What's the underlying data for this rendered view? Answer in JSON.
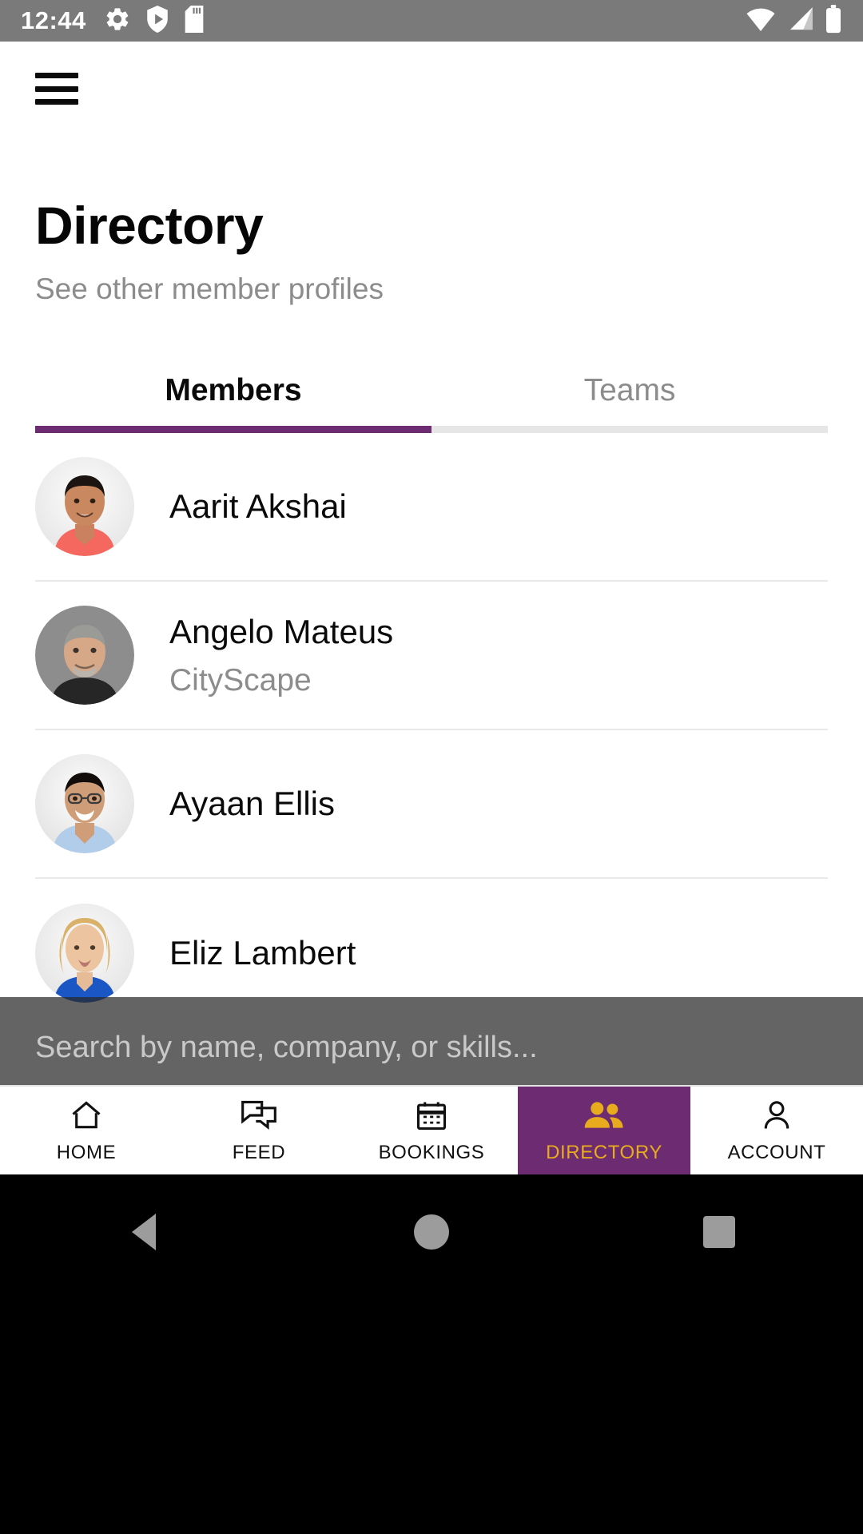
{
  "status_bar": {
    "time": "12:44",
    "left_icons": [
      "gear-icon",
      "shield-play-icon",
      "sd-card-icon"
    ],
    "right_icons": [
      "wifi-icon",
      "cell-signal-icon",
      "battery-icon"
    ],
    "background_color": "#7a7a7a"
  },
  "appbar": {
    "menu_icon": "hamburger-menu-icon"
  },
  "header": {
    "title": "Directory",
    "subtitle": "See other member profiles"
  },
  "tabs": {
    "items": [
      {
        "label": "Members",
        "active": true
      },
      {
        "label": "Teams",
        "active": false
      }
    ],
    "active_color": "#6d2c71",
    "inactive_color": "#e6e6e6"
  },
  "members": [
    {
      "name": "Aarit Akshai",
      "company": ""
    },
    {
      "name": "Angelo Mateus",
      "company": "CityScape"
    },
    {
      "name": "Ayaan Ellis",
      "company": ""
    },
    {
      "name": "Eliz Lambert",
      "company": ""
    }
  ],
  "search": {
    "placeholder": "Search by name, company, or skills...",
    "value": ""
  },
  "bottom_nav": {
    "items": [
      {
        "label": "HOME",
        "icon": "home-icon",
        "active": false
      },
      {
        "label": "FEED",
        "icon": "chat-bubbles-icon",
        "active": false
      },
      {
        "label": "BOOKINGS",
        "icon": "calendar-icon",
        "active": false
      },
      {
        "label": "DIRECTORY",
        "icon": "people-icon",
        "active": true
      },
      {
        "label": "ACCOUNT",
        "icon": "person-icon",
        "active": false
      }
    ],
    "active_background": "#6d2c71",
    "active_foreground": "#e8ab1d"
  },
  "system_nav": {
    "buttons": [
      "back-button",
      "home-button",
      "recents-button"
    ]
  }
}
